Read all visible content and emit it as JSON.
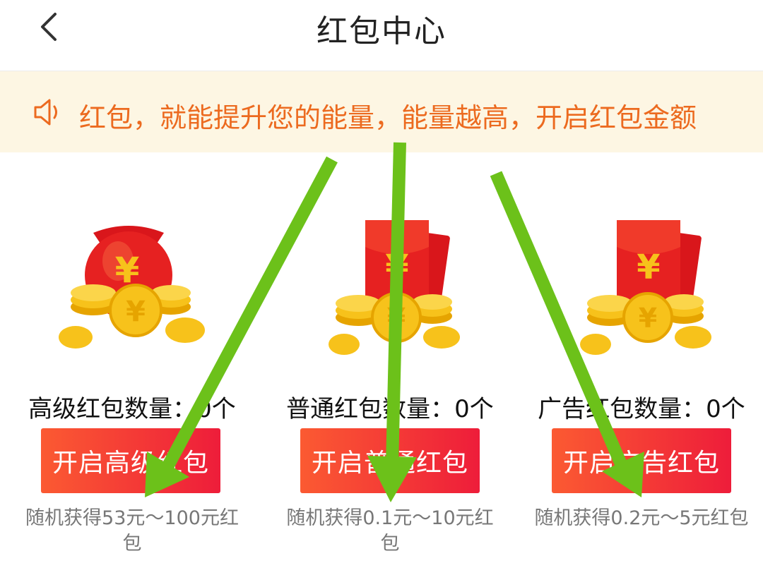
{
  "header": {
    "title": "红包中心",
    "back_icon": "chevron-left-icon"
  },
  "notice": {
    "icon": "speaker-icon",
    "text": "红包，就能提升您的能量，能量越高，开启红包金额"
  },
  "cards": [
    {
      "count_label": "高级红包数量：0个",
      "button_label": "开启高级红包",
      "desc": "随机获得53元～100元红包",
      "illustration": "money-bag-with-coins"
    },
    {
      "count_label": "普通红包数量：0个",
      "button_label": "开启普通红包",
      "desc": "随机获得0.1元～10元红包",
      "illustration": "red-envelope-with-coins"
    },
    {
      "count_label": "广告红包数量：0个",
      "button_label": "开启广告红包",
      "desc": "随机获得0.2元～5元红包",
      "illustration": "red-envelope-with-coins"
    }
  ],
  "colors": {
    "accent_orange": "#ec6a1f",
    "notice_bg": "#fdf6e3",
    "button_start": "#fb5a32",
    "button_end": "#ee1d3a",
    "annotation_arrow": "#6cc11a"
  }
}
